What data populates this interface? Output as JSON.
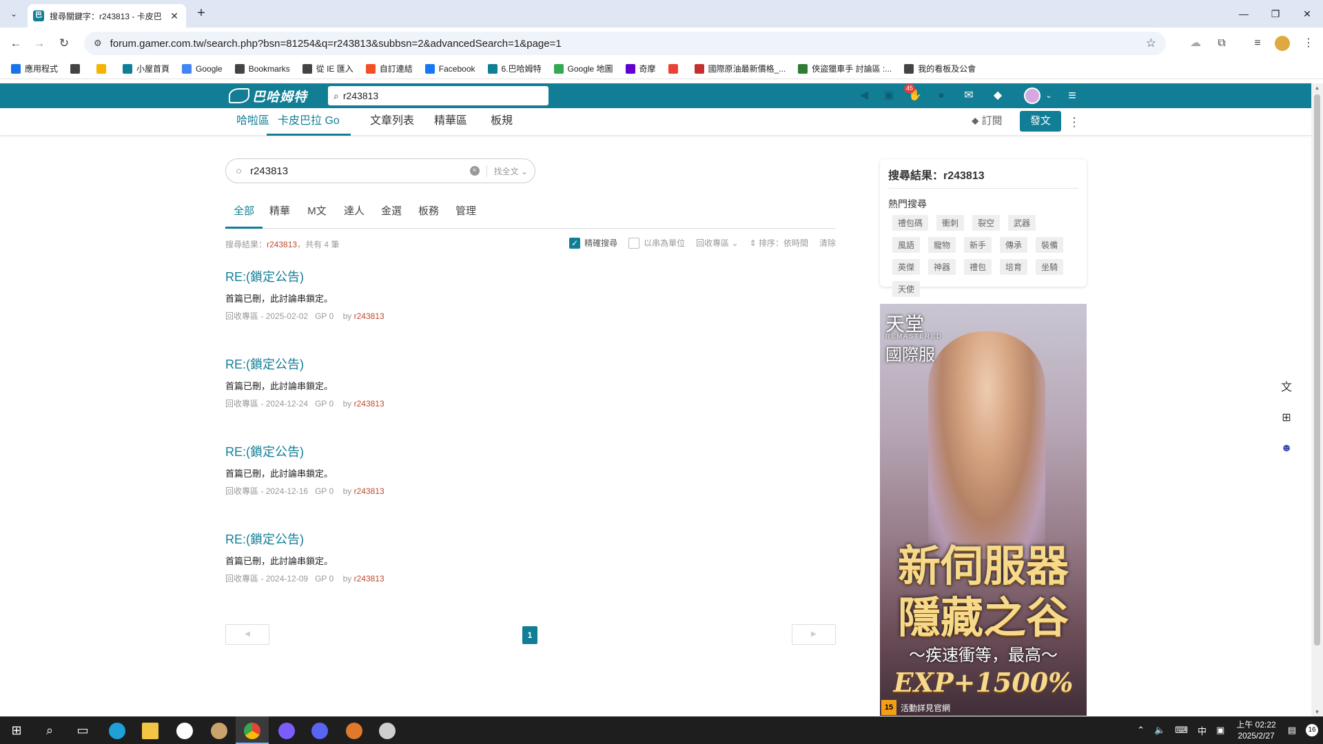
{
  "browser": {
    "tab_title": "搜尋關鍵字：r243813 - 卡皮巴",
    "tab_close": "✕",
    "new_tab": "+",
    "url": "forum.gamer.com.tw/search.php?bsn=81254&q=r243813&subbsn=2&advancedSearch=1&page=1",
    "icons": {
      "back": "arrow-left-icon",
      "forward": "arrow-right-icon",
      "reload": "reload-icon",
      "star": "star-icon"
    }
  },
  "bookmarks": [
    {
      "label": "應用程式",
      "icon": "apps-grid-icon",
      "color": "#1a73e8"
    },
    {
      "label": "",
      "icon": "grid-icon",
      "color": "#444444"
    },
    {
      "label": "",
      "icon": "bookmark-logo-icon",
      "color": "#f4b400"
    },
    {
      "label": "小屋首頁",
      "icon": "bahamut-icon",
      "color": "#117e96"
    },
    {
      "label": "Google",
      "icon": "google-icon",
      "color": "#4285f4"
    },
    {
      "label": "Bookmarks",
      "icon": "star-icon",
      "color": "#444444"
    },
    {
      "label": "從 IE 匯入",
      "icon": "folder-icon",
      "color": "#444444"
    },
    {
      "label": "自訂連結",
      "icon": "windows-icon",
      "color": "#f25022"
    },
    {
      "label": "Facebook",
      "icon": "facebook-icon",
      "color": "#1877f2"
    },
    {
      "label": "6.巴哈姆特",
      "icon": "bahamut-icon",
      "color": "#117e96"
    },
    {
      "label": "Google 地圖",
      "icon": "maps-pin-icon",
      "color": "#34a853"
    },
    {
      "label": "奇摩",
      "icon": "yahoo-icon",
      "color": "#6001d2"
    },
    {
      "label": "",
      "icon": "google-icon",
      "color": "#ea4335"
    },
    {
      "label": "國際原油最新價格_...",
      "icon": "ig-icon",
      "color": "#c4302b"
    },
    {
      "label": "俠盜獵車手 討論區 :...",
      "icon": "clover-icon",
      "color": "#2e7d32"
    },
    {
      "label": "我的看板及公會",
      "icon": "globe-icon",
      "color": "#444444"
    }
  ],
  "site": {
    "logo": "巴哈姆特",
    "search_value": "r243813",
    "notif_count": "45",
    "subnav": [
      "哈啦區",
      "卡皮巴拉 Go",
      "文章列表",
      "精華區",
      "板規"
    ],
    "subnav_active": 1,
    "subscribe_label": "訂閱",
    "post_label": "發文"
  },
  "search": {
    "query": "r243813",
    "scope": "找全文",
    "tabs": [
      "全部",
      "精華",
      "M文",
      "達人",
      "金選",
      "板務",
      "管理"
    ],
    "active_tab": 0,
    "summary_prefix": "搜尋結果：",
    "summary_keyword": "r243813",
    "summary_suffix": "，共有 4 筆",
    "options": {
      "exact": "精確搜尋",
      "exact_checked": true,
      "by_thread": "以串為單位",
      "by_thread_checked": false,
      "board_filter": "回收專區",
      "sort": "排序：依時間",
      "clear": "清除"
    }
  },
  "results": [
    {
      "title": "RE:(鎖定公告)",
      "snippet": "首篇已刪，此討論串鎖定。",
      "board": "回收專區",
      "date": "2025-02-02",
      "gp": "GP 0",
      "by": "by",
      "author": "r243813"
    },
    {
      "title": "RE:(鎖定公告)",
      "snippet": "首篇已刪，此討論串鎖定。",
      "board": "回收專區",
      "date": "2024-12-24",
      "gp": "GP 0",
      "by": "by",
      "author": "r243813"
    },
    {
      "title": "RE:(鎖定公告)",
      "snippet": "首篇已刪，此討論串鎖定。",
      "board": "回收專區",
      "date": "2024-12-16",
      "gp": "GP 0",
      "by": "by",
      "author": "r243813"
    },
    {
      "title": "RE:(鎖定公告)",
      "snippet": "首篇已刪，此討論串鎖定。",
      "board": "回收專區",
      "date": "2024-12-09",
      "gp": "GP 0",
      "by": "by",
      "author": "r243813"
    }
  ],
  "pager": {
    "prev": "◀",
    "next": "▶",
    "current": "1"
  },
  "sidebar": {
    "title": "搜尋結果：r243813",
    "hot_label": "熱門搜尋",
    "hot_tags": [
      "禮包碼",
      "衝刺",
      "裂空",
      "武器",
      "風語",
      "寵物",
      "新手",
      "傳承",
      "裝備",
      "英傑",
      "神器",
      "禮包",
      "培育",
      "坐騎",
      "天使"
    ]
  },
  "ad": {
    "brand": "天堂",
    "brand_sub": "REMASTERED",
    "brand_2": "國際服",
    "line1": "新伺服器",
    "line2": "隱藏之谷",
    "line3": "～疾速衝等，最高～",
    "line4": "EXP+1500%",
    "rating": "15",
    "footer": "活動詳見官網"
  },
  "taskbar": {
    "time": "上午 02:22",
    "date": "2025/2/27",
    "ime": "中",
    "notif": "16"
  },
  "colors": {
    "brand": "#117e96",
    "keyword": "#c04a2b"
  }
}
